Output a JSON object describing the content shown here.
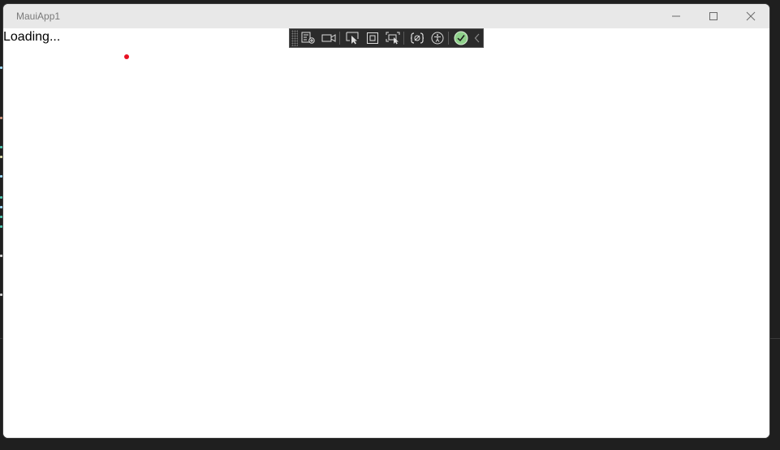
{
  "window": {
    "title": "MauiApp1"
  },
  "content": {
    "loading_text": "Loading..."
  },
  "toolbar": {
    "items": [
      {
        "name": "go-to-live-visual-tree"
      },
      {
        "name": "show-in-app-toolbar"
      },
      {
        "name": "select-element"
      },
      {
        "name": "display-layout-adorners"
      },
      {
        "name": "track-focused-element"
      },
      {
        "name": "binding-failures"
      },
      {
        "name": "scan-accessibility"
      },
      {
        "name": "hot-reload-status"
      },
      {
        "name": "collapse-toolbar"
      }
    ]
  },
  "colors": {
    "window_bg": "#ffffff",
    "titlebar_bg": "#e8e8e8",
    "toolbar_bg": "#2b2b2b",
    "hot_reload_ok": "#8fd18b",
    "dot": "#e81123"
  }
}
